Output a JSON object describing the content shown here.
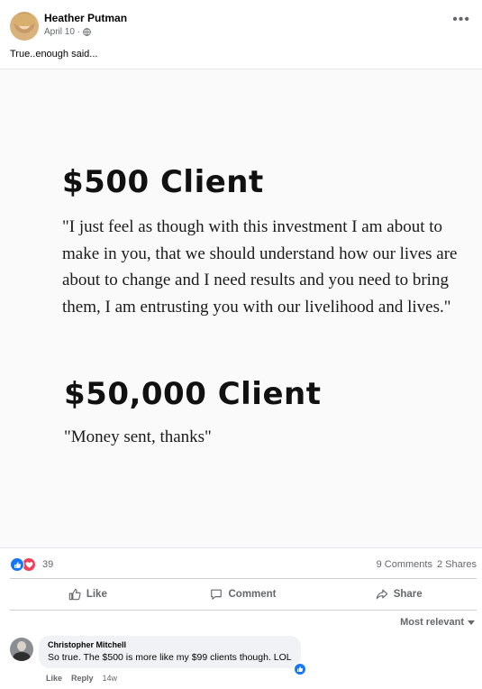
{
  "post": {
    "author": "Heather Putman",
    "date": "April 10 ·",
    "caption": "True..enough said...",
    "more_icon": "more-horizontal-icon"
  },
  "image_text": {
    "heading1": "$500 Client",
    "quote1": "\"I just feel as though with this investment I am about to make in you, that we should understand how our lives are about to change and I need results and you need to bring them, I am entrusting you with our livelihood and lives.\"",
    "heading2": "$50,000 Client",
    "quote2": "\"Money sent, thanks\""
  },
  "reactions": {
    "count": "39",
    "comments": "9 Comments",
    "shares": "2 Shares",
    "types": [
      "like-icon",
      "love-icon"
    ],
    "colors": {
      "like": "#1877f2",
      "love": "#f33e58"
    }
  },
  "actions": {
    "like": "Like",
    "comment": "Comment",
    "share": "Share"
  },
  "sort": {
    "label": "Most relevant"
  },
  "comment": {
    "author": "Christopher Mitchell",
    "text": "So true. The $500 is more like my $99 clients though. LOL",
    "like": "Like",
    "reply": "Reply",
    "time": "14w"
  }
}
